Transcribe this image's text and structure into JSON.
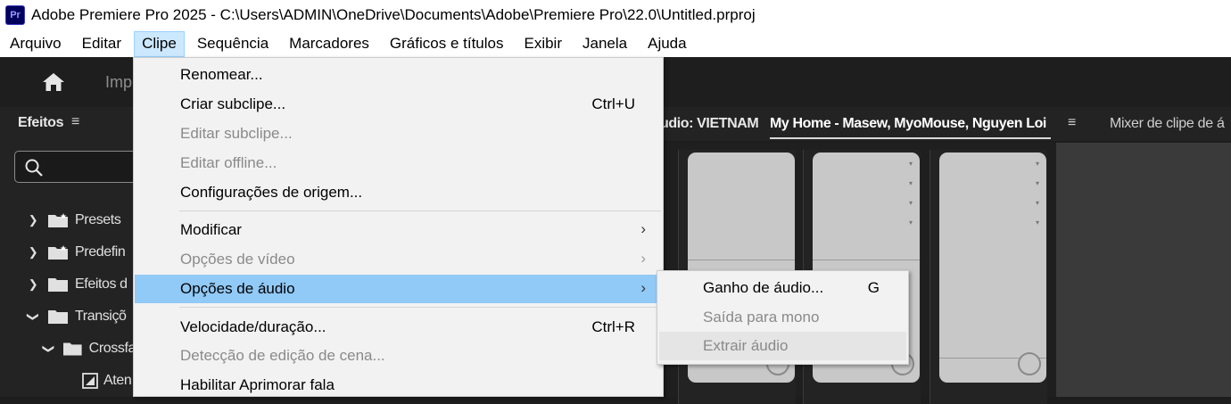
{
  "window": {
    "app_icon": "Pr",
    "title": "Adobe Premiere Pro 2025 - C:\\Users\\ADMIN\\OneDrive\\Documents\\Adobe\\Premiere Pro\\22.0\\Untitled.prproj"
  },
  "menubar": [
    {
      "label": "Arquivo",
      "active": false
    },
    {
      "label": "Editar",
      "active": false
    },
    {
      "label": "Clipe",
      "active": true
    },
    {
      "label": "Sequência",
      "active": false
    },
    {
      "label": "Marcadores",
      "active": false
    },
    {
      "label": "Gráficos e títulos",
      "active": false
    },
    {
      "label": "Exibir",
      "active": false
    },
    {
      "label": "Janela",
      "active": false
    },
    {
      "label": "Ajuda",
      "active": false
    }
  ],
  "topbar": {
    "home_icon": "home-icon",
    "partial_label": "Imp"
  },
  "effects_panel": {
    "title": "Efeitos",
    "menu_glyph": "≡",
    "search_icon": "search-icon",
    "tree": [
      {
        "label": "Presets",
        "expanded": false,
        "icon": "folder-star-icon"
      },
      {
        "label": "Predefin",
        "expanded": false,
        "icon": "folder-star-icon"
      },
      {
        "label": "Efeitos d",
        "expanded": false,
        "icon": "folder-icon"
      },
      {
        "label": "Transiçõ",
        "expanded": true,
        "icon": "folder-icon"
      },
      {
        "label": "Crossfa",
        "expanded": true,
        "icon": "folder-icon"
      },
      {
        "label": "Aten",
        "expanded": false,
        "icon": "transition-icon"
      }
    ]
  },
  "panel_tabs": {
    "source_tab": "udio: VIETNAM",
    "active_tab": "My Home - Masew, MyoMouse, Nguyen Loi",
    "menu_glyph": "≡",
    "mixer_tab": "Mixer de clipe de á"
  },
  "clip_menu": {
    "items": [
      {
        "label": "Renomear...",
        "shortcut": "",
        "disabled": false,
        "submenu": false
      },
      {
        "label": "Criar subclipe...",
        "shortcut": "Ctrl+U",
        "disabled": false,
        "submenu": false
      },
      {
        "label": "Editar subclipe...",
        "shortcut": "",
        "disabled": true,
        "submenu": false
      },
      {
        "label": "Editar offline...",
        "shortcut": "",
        "disabled": true,
        "submenu": false
      },
      {
        "label": "Configurações de origem...",
        "shortcut": "",
        "disabled": false,
        "submenu": false
      },
      {
        "label": "Modificar",
        "shortcut": "",
        "disabled": false,
        "submenu": true
      },
      {
        "label": "Opções de vídeo",
        "shortcut": "",
        "disabled": true,
        "submenu": true
      },
      {
        "label": "Opções de áudio",
        "shortcut": "",
        "disabled": false,
        "submenu": true,
        "highlighted": true
      },
      {
        "label": "Velocidade/duração...",
        "shortcut": "Ctrl+R",
        "disabled": false,
        "submenu": false
      },
      {
        "label": "Detecção de edição de cena...",
        "shortcut": "",
        "disabled": true,
        "submenu": false
      },
      {
        "label": "Habilitar Aprimorar fala",
        "shortcut": "",
        "disabled": false,
        "submenu": false
      }
    ]
  },
  "audio_submenu": {
    "items": [
      {
        "label": "Ganho de áudio...",
        "shortcut": "G",
        "disabled": false
      },
      {
        "label": "Saída para mono",
        "shortcut": "",
        "disabled": true
      },
      {
        "label": "Extrair áudio",
        "shortcut": "",
        "disabled": true,
        "hovered": true
      }
    ]
  },
  "colors": {
    "menu_highlight": "#91c9f7",
    "menubar_active": "#cce8ff",
    "panel_bg": "#232323",
    "app_icon_bg": "#00005b"
  }
}
